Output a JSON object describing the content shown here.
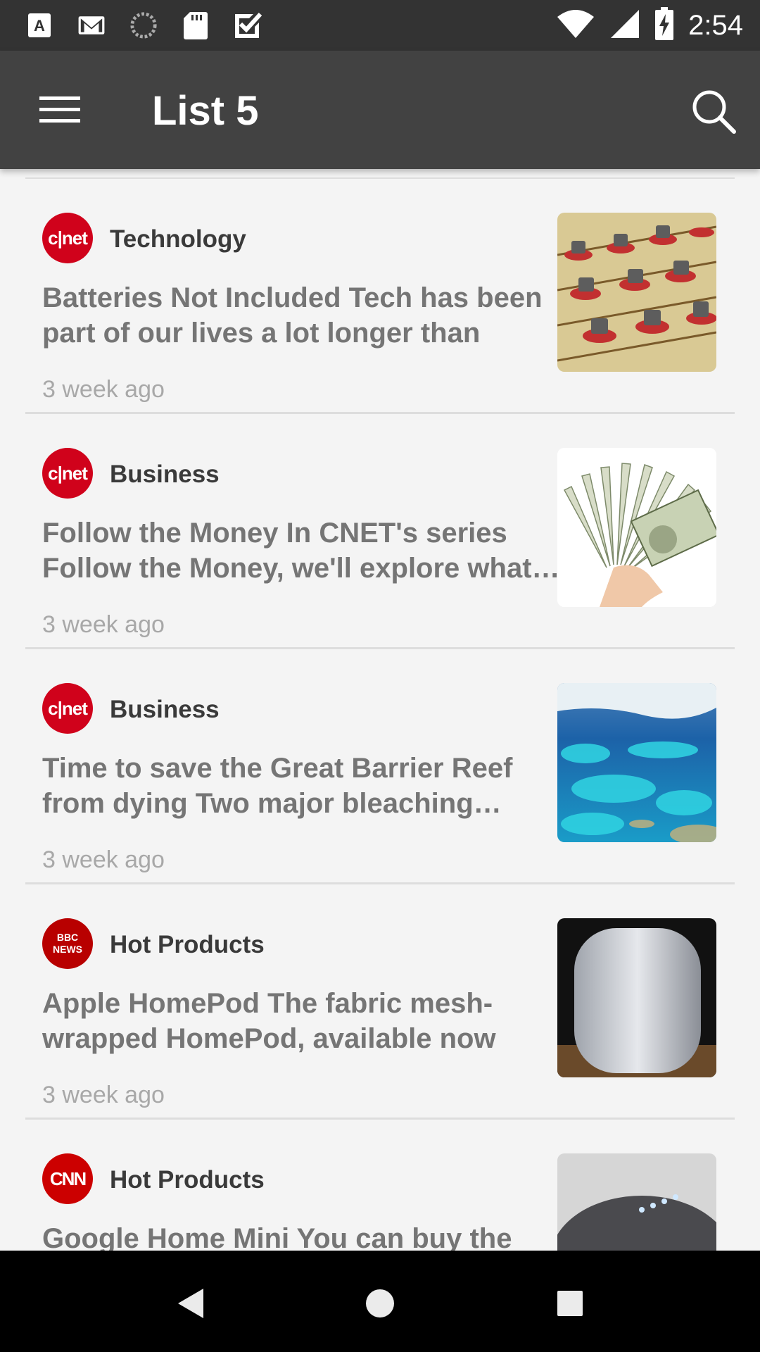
{
  "status_bar": {
    "time": "2:54",
    "left_icons": [
      "font-a-icon",
      "gmail-icon",
      "sync-circle-icon",
      "sd-card-icon",
      "checkbox-icon"
    ],
    "right_icons": [
      "wifi-icon",
      "signal-icon",
      "battery-charging-icon"
    ]
  },
  "app_bar": {
    "title": "List 5",
    "menu_icon": "menu-icon",
    "search_icon": "search-icon"
  },
  "articles": [
    {
      "source_logo": "c|net",
      "category": "Technology",
      "headline": "Batteries Not Included Tech has been part of our lives a lot longer than",
      "time": "3 week ago"
    },
    {
      "source_logo": "c|net",
      "category": "Business",
      "headline": "Follow the Money In CNET's series Follow the Money, we'll explore what it means",
      "time": "3 week ago"
    },
    {
      "source_logo": "c|net",
      "category": "Business",
      "headline": "Time to save the Great Barrier Reef from dying Two major bleaching events",
      "time": "3 week ago"
    },
    {
      "source_logo": "BBC NEWS",
      "category": "Hot Products",
      "headline": "Apple HomePod The fabric mesh-wrapped HomePod, available now",
      "time": "3 week ago"
    },
    {
      "source_logo": "CNN",
      "category": "Hot Products",
      "headline": "Google Home Mini You can buy the",
      "time": "3 week ago"
    }
  ],
  "colors": {
    "app_bar": "#424242",
    "status_bar": "#333333",
    "cnet_red": "#d0021b",
    "bbc_red": "#b80000",
    "cnn_red": "#cc0000",
    "background": "#f4f4f4"
  },
  "nav_bar": {
    "back_icon": "back-triangle-icon",
    "home_icon": "home-circle-icon",
    "recents_icon": "recents-square-icon"
  }
}
